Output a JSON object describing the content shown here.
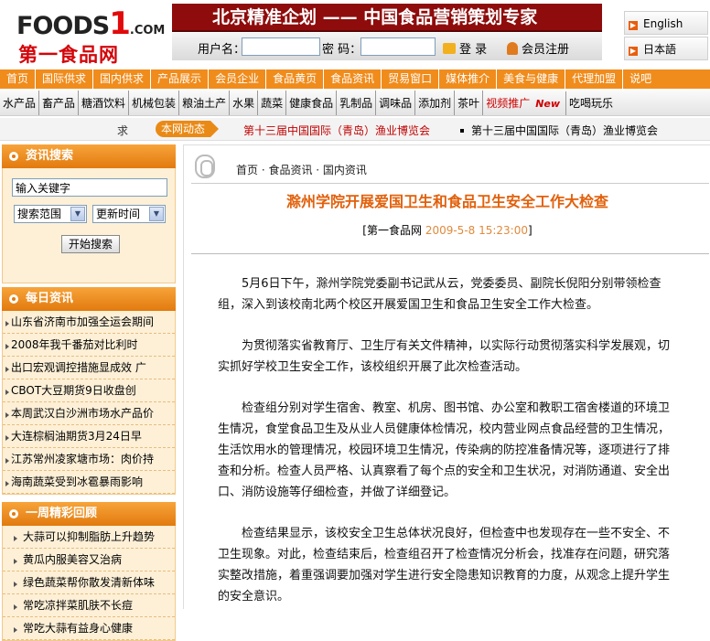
{
  "header": {
    "logo_brand": "FOODS",
    "logo_one": "1",
    "logo_com": ".COM",
    "logo_cn": "第一食品网",
    "banner": "北京精准企划 —— 中国食品营销策划专家",
    "login": {
      "username_label": "用户名：",
      "password_label": "密  码：",
      "login_btn": "登 录",
      "register_btn": "会员注册"
    },
    "langs": [
      "English",
      "日本語"
    ]
  },
  "nav_primary": [
    "首页",
    "国际供求",
    "国内供求",
    "产品展示",
    "会员企业",
    "食品黄页",
    "食品资讯",
    "贸易窗口",
    "媒体推介",
    "美食与健康",
    "代理加盟",
    "说吧"
  ],
  "nav_categories": [
    "水产品",
    "畜产品",
    "糖酒饮料",
    "机械包装",
    "粮油土产",
    "水果",
    "蔬菜",
    "健康食品",
    "乳制品",
    "调味品",
    "添加剂",
    "茶叶"
  ],
  "nav_video": "视频推广",
  "nav_new": "New",
  "nav_extra": "吃喝玩乐",
  "ticker": {
    "prefix": "求",
    "badge": "本网动态",
    "item1": "第十三届中国国际（青岛）渔业博览会",
    "item2": "第十三届中国国际（青岛）渔业博览会"
  },
  "sidebar": {
    "search": {
      "title": "资讯搜索",
      "placeholder": "输入关键字",
      "scope": "搜索范围",
      "time": "更新时间",
      "button": "开始搜索"
    },
    "daily": {
      "title": "每日资讯",
      "items": [
        "山东省济南市加强全运会期间",
        "2008年我千番茄对比利时",
        "出口宏观调控措施显成效 广",
        "CBOT大豆期货9日收盘创",
        "本周武汉白沙洲市场水产品价",
        "大连棕榈油期货3月24日早",
        "江苏常州凌家塘市场：肉价持",
        "海南蔬菜受到冰雹暴雨影响"
      ]
    },
    "weekly": {
      "title": "一周精彩回顾",
      "items": [
        "大蒜可以抑制脂肪上升趋势",
        "黄瓜内服美容又治病",
        "绿色蔬菜帮你散发清新体味",
        "常吃凉拌菜肌肤不长痘",
        "常吃大蒜有益身心健康"
      ]
    }
  },
  "article": {
    "breadcrumb": "首页 · 食品资讯 · 国内资讯",
    "title": "滁州学院开展爱国卫生和食品卫生安全工作大检查",
    "source": "[第一食品网",
    "date": "2009-5-8 15:23:00",
    "source_end": "]",
    "paragraphs": [
      "5月6日下午，滁州学院党委副书记武从云，党委委员、副院长倪阳分别带领检查组，深入到该校南北两个校区开展爱国卫生和食品卫生安全工作大检查。",
      "为贯彻落实省教育厅、卫生厅有关文件精神，以实际行动贯彻落实科学发展观，切实抓好学校卫生安全工作，该校组织开展了此次检查活动。",
      "检查组分别对学生宿舍、教室、机房、图书馆、办公室和教职工宿舍楼道的环境卫生情况，食堂食品卫生及从业人员健康体检情况，校内营业网点食品经营的卫生情况，生活饮用水的管理情况，校园环境卫生情况，传染病的防控准备情况等，逐项进行了排查和分析。检查人员严格、认真察看了每个点的安全和卫生状况，对消防通道、安全出口、消防设施等仔细检查，并做了详细登记。",
      "检查结果显示，该校安全卫生总体状况良好，但检查中也发现存在一些不安全、不卫生现象。对此，检查结束后，检查组召开了检查情况分析会，找准存在问题，研究落实整改措施，着重强调要加强对学生进行安全隐患知识教育的力度，从观念上提升学生的安全意识。"
    ]
  },
  "colors": {
    "accent": "#f08c1c",
    "banner": "#8e0c0c",
    "title": "#e2600b",
    "link_red": "#c00000"
  }
}
